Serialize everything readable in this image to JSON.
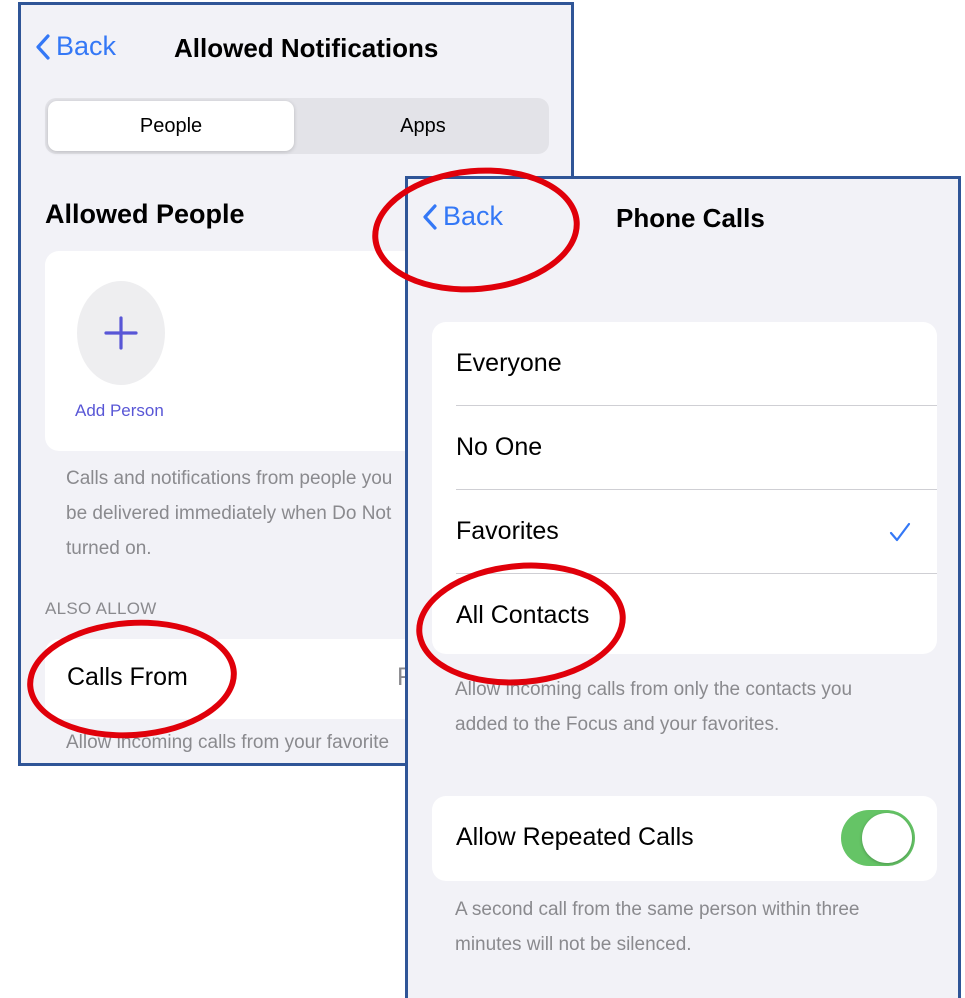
{
  "allowed_notifications": {
    "back_label": "Back",
    "title": "Allowed Notifications",
    "segments": [
      "People",
      "Apps"
    ],
    "selected_segment": "People",
    "section_title": "Allowed People",
    "add_person_label": "Add Person",
    "footer_lines": [
      "Calls and notifications from people you",
      "be delivered immediately when Do Not",
      "turned on."
    ],
    "also_allow_header": "ALSO ALLOW",
    "calls_from_label": "Calls From",
    "calls_from_value": "F",
    "calls_from_footer": "Allow incoming calls from your favorite"
  },
  "phone_calls": {
    "back_label": "Back",
    "title": "Phone Calls",
    "options": [
      "Everyone",
      "No One",
      "Favorites",
      "All Contacts"
    ],
    "selected_option": "Favorites",
    "options_footer_lines": [
      "Allow incoming calls from only the contacts you",
      "added to the Focus and your favorites."
    ],
    "repeated_calls_label": "Allow Repeated Calls",
    "repeated_calls_enabled": true,
    "repeated_calls_footer_lines": [
      "A second call from the same person within three",
      "minutes will not be silenced."
    ]
  },
  "colors": {
    "accent_blue": "#3478f6",
    "add_person_purple": "#5856d6",
    "toggle_green": "#65c466",
    "highlight_red": "#e0000a",
    "frame_blue": "#2f5597"
  }
}
